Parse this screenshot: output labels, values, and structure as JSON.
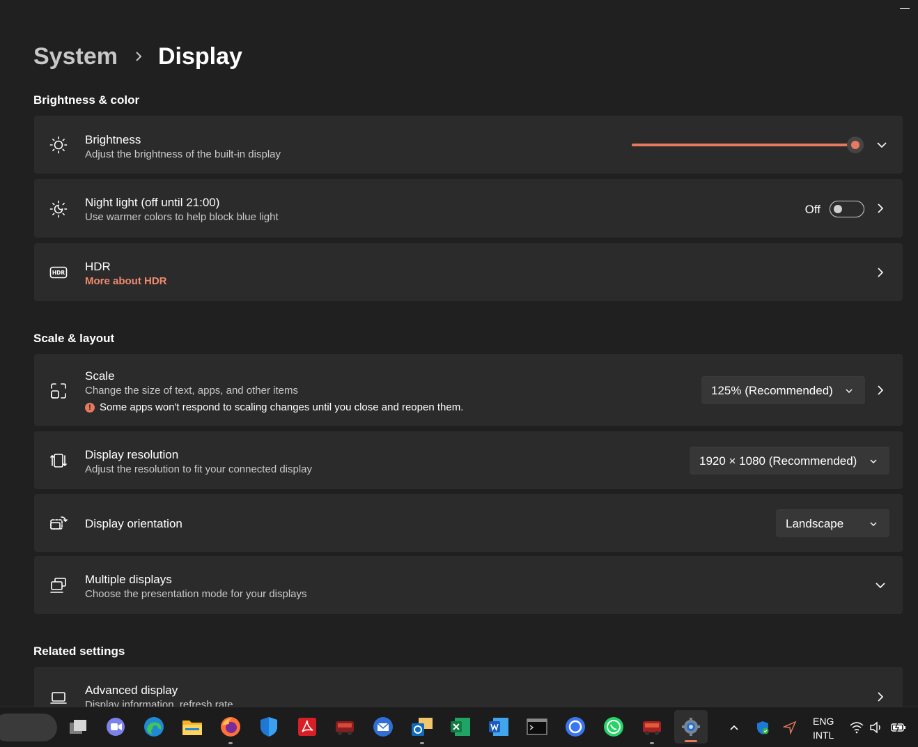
{
  "breadcrumb": {
    "parent": "System",
    "current": "Display"
  },
  "sections": {
    "brightness_color": "Brightness & color",
    "scale_layout": "Scale & layout",
    "related": "Related settings"
  },
  "brightness": {
    "title": "Brightness",
    "subtitle": "Adjust the brightness of the built-in display",
    "level_percent": 100
  },
  "night_light": {
    "title": "Night light (off until 21:00)",
    "subtitle": "Use warmer colors to help block blue light",
    "state": "Off"
  },
  "hdr": {
    "title": "HDR",
    "link": "More about HDR"
  },
  "scale": {
    "title": "Scale",
    "subtitle": "Change the size of text, apps, and other items",
    "warning": "Some apps won't respond to scaling changes until you close and reopen them.",
    "value": "125% (Recommended)"
  },
  "resolution": {
    "title": "Display resolution",
    "subtitle": "Adjust the resolution to fit your connected display",
    "value": "1920 × 1080 (Recommended)"
  },
  "orientation": {
    "title": "Display orientation",
    "value": "Landscape"
  },
  "multiple": {
    "title": "Multiple displays",
    "subtitle": "Choose the presentation mode for your displays"
  },
  "advanced": {
    "title": "Advanced display",
    "subtitle": "Display information, refresh rate"
  },
  "taskbar": {
    "language": {
      "line1": "ENG",
      "line2": "INTL"
    },
    "apps": [
      "task-view",
      "teams",
      "edge",
      "file-explorer",
      "firefox",
      "defender",
      "acrobat",
      "game",
      "mail",
      "outlook",
      "excel",
      "word",
      "terminal",
      "signal",
      "whatsapp",
      "game-2",
      "settings"
    ]
  },
  "colors": {
    "accent": "#e8795e",
    "background": "#202020",
    "card": "#2b2b2b"
  }
}
